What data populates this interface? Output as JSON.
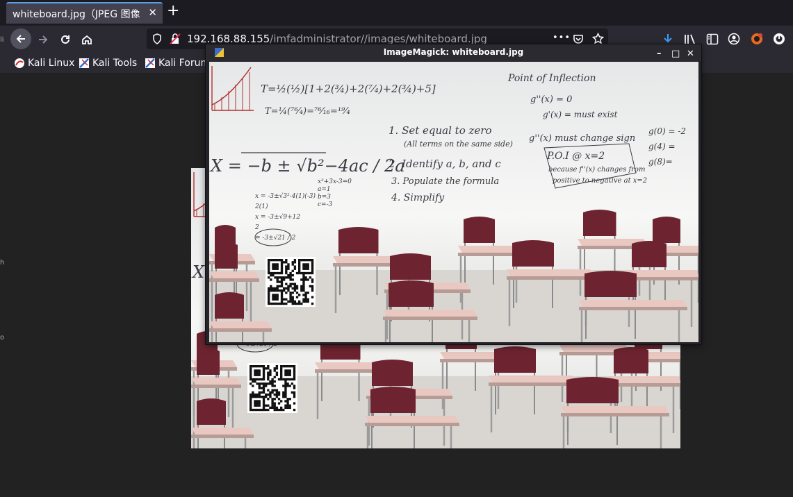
{
  "browser": {
    "tab": {
      "title": "whiteboard.jpg（JPEG 图像",
      "close": "✕"
    },
    "new_tab": "+",
    "url": {
      "prefix": "192.168.88.155",
      "rest": "/imfadministrator//images/whiteboard.jpg"
    },
    "url_more": "•••",
    "bookmarks": [
      {
        "label": "Kali Linux"
      },
      {
        "label": "Kali Tools"
      },
      {
        "label": "Kali Forum"
      }
    ],
    "toolbar_icons": [
      "download-icon",
      "library-icon",
      "sidebar-icon",
      "account-icon",
      "extension-icon",
      "power-icon"
    ]
  },
  "imagemagick": {
    "title": "ImageMagick: whiteboard.jpg",
    "controls": {
      "minimize": "–",
      "maximize": "□",
      "close": "✕"
    }
  },
  "whiteboard": {
    "left_block": [
      "T=½(½)[1+2(¾)+2(⁷⁄₄)+2(¾)+5]",
      "T=¼(⁷⁶⁄₄)=⁷⁶⁄₁₆=¹⁹⁄₄"
    ],
    "quadratic": "X = −b ± √b²−4ac / 2a",
    "steps": [
      "1. Set equal to zero",
      "(All terms on the same side)",
      "2. Identify a, b, and c",
      "3. Populate the formula",
      "4. Simplify"
    ],
    "poi_title": "Point of Inflection",
    "poi_lines": [
      "g''(x) = 0",
      "g'(x) = must exist",
      "g''(x) must change sign",
      "P.O.I @ x=2",
      "because f''(x) changes from",
      "positive to negative at x=2"
    ],
    "far_right": [
      "g(0) = -2",
      "g(4) =",
      "g(8)="
    ],
    "small_eq": [
      "x²+3x-3=0",
      "a=1",
      "b=3",
      "c=-3"
    ],
    "work": [
      "x = -3±√3²-4(1)(-3)",
      "2(1)",
      "x = -3±√9+12",
      "2",
      "= -3±√21 / 2"
    ]
  },
  "left_edge_chars": [
    "li",
    "h",
    "o"
  ]
}
